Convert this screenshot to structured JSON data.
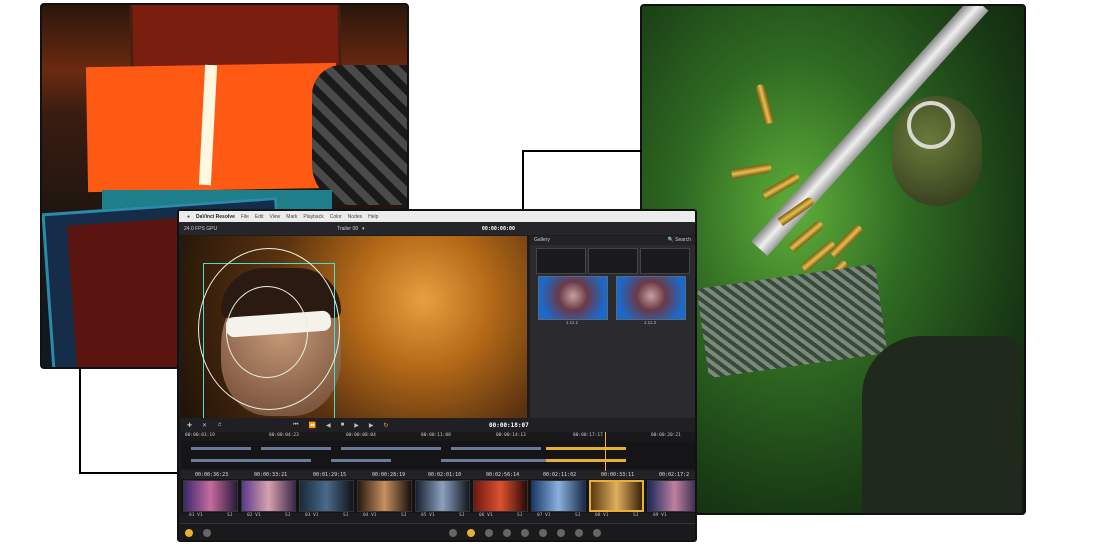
{
  "resolve": {
    "menu": [
      "DaVinci Resolve",
      "File",
      "Edit",
      "View",
      "Mark",
      "Playback",
      "Color",
      "Nodes",
      "Help"
    ],
    "fps": "24.0 FPS  GPU",
    "project": "Trailer 08",
    "timecode_top": "00:00:00:00",
    "gallery_title": "Gallery",
    "gallery_search": "Search",
    "stills": [
      "1.11.1",
      "1.11.2"
    ],
    "timecode_viewer": "00:00:18:07",
    "ruler": [
      "00:00:01:19",
      "00:00:04:23",
      "00:00:08:04",
      "00:00:11:08",
      "00:00:14:13",
      "00:00:17:17",
      "00:00:20:21"
    ],
    "clip_timecodes": [
      "00:00:36:23",
      "00:00:33:21",
      "00:01:29:15",
      "00:00:28:19",
      "00:02:01:10",
      "00:02:56:14",
      "00:02:11:02",
      "00:00:33:11",
      "00:02:17:2"
    ],
    "clip_labels": [
      "01 V1",
      "SJ",
      "02 V1",
      "SJ",
      "03 V1",
      "SJ",
      "04 V1",
      "SJ",
      "05 V1",
      "SJ",
      "06 V1",
      "SJ",
      "07 V1",
      "SJ",
      "08 V1",
      "SJ",
      "09 V1"
    ]
  }
}
